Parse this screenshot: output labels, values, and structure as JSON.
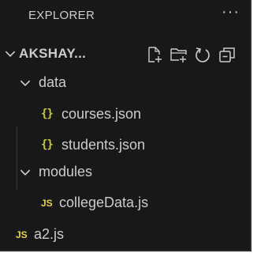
{
  "header": {
    "title": "EXPLORER",
    "more_label": "···"
  },
  "project": {
    "name": "AKSHAY...",
    "icons": [
      "new-file-icon",
      "new-folder-icon",
      "refresh-icon",
      "collapse-all-icon"
    ]
  },
  "tree": {
    "data_folder": "data",
    "courses_file": "courses.json",
    "students_file": "students.json",
    "modules_folder": "modules",
    "collegedata_file": "collegeData.js",
    "a2_file": "a2.js",
    "json_icon_text": "{}",
    "js_icon_text": "JS"
  },
  "colors": {
    "background": "#181818",
    "text": "#cccccc",
    "json_icon": "#cbcb41",
    "js_icon": "#e8d44d"
  }
}
